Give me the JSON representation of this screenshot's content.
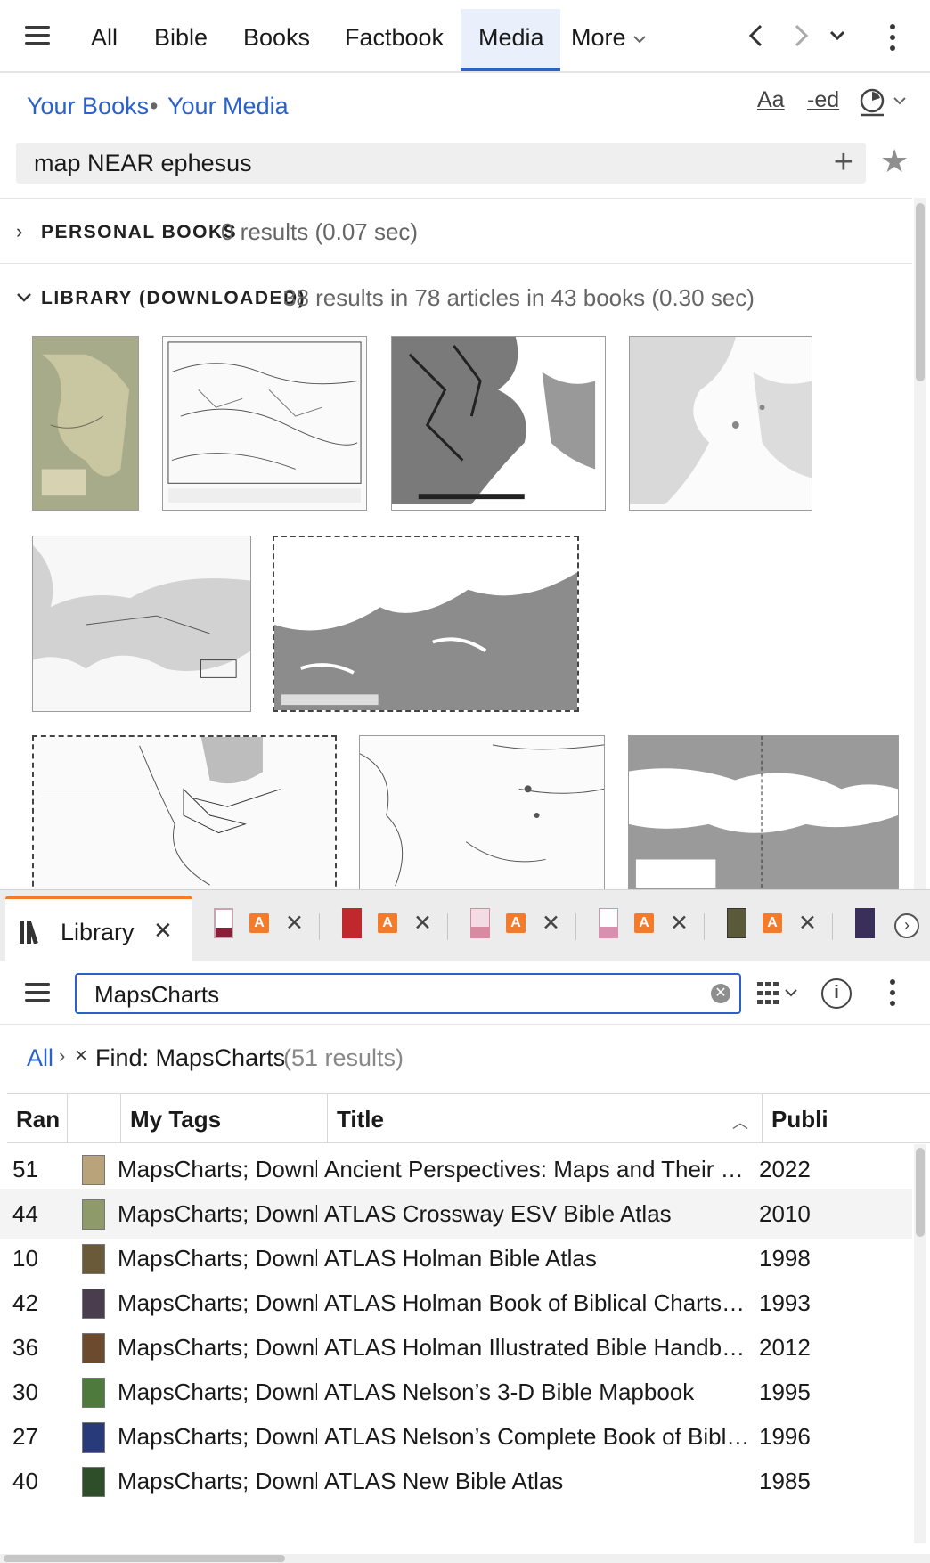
{
  "nav": {
    "tabs": [
      "All",
      "Bible",
      "Books",
      "Factbook",
      "Media"
    ],
    "active_tab": "Media",
    "more_label": "More"
  },
  "scope": {
    "your_books": "Your Books",
    "separator": "•",
    "your_media": "Your Media",
    "font_tool": "Aa",
    "ed_tool": "-ed"
  },
  "search": {
    "query": "map NEAR ephesus"
  },
  "sections": {
    "personal": {
      "title": "PERSONAL BOOKS",
      "meta": "0 results (0.07 sec)"
    },
    "library": {
      "title": "LIBRARY (DOWNLOADED)",
      "meta": "38 results in 78 articles in 43 books (0.30 sec)"
    }
  },
  "library_panel": {
    "tab_label": "Library",
    "doc_tab_badge": "A",
    "search_value": "MapsCharts",
    "breadcrumb": {
      "all": "All",
      "find": "Find: MapsCharts",
      "count": "(51 results)"
    },
    "columns": [
      "Ran",
      "",
      "My Tags",
      "Title",
      "Publi"
    ],
    "rows": [
      {
        "rank": "51",
        "tags": "MapsCharts; Downloa",
        "title": "Ancient Perspectives: Maps and Their Place in Mesopotamia, Egypt, Greece, and Rome",
        "year": "2022"
      },
      {
        "rank": "44",
        "tags": "MapsCharts; Downloa",
        "title": "ATLAS Crossway ESV Bible Atlas",
        "year": "2010"
      },
      {
        "rank": "10",
        "tags": "MapsCharts; Downloa",
        "title": "ATLAS Holman Bible Atlas",
        "year": "1998"
      },
      {
        "rank": "42",
        "tags": "MapsCharts; Downloa",
        "title": "ATLAS Holman Book of Biblical Charts, Maps, and Reconstructions",
        "year": "1993"
      },
      {
        "rank": "36",
        "tags": "MapsCharts; Downloa",
        "title": "ATLAS Holman Illustrated Bible Handbook",
        "year": "2012"
      },
      {
        "rank": "30",
        "tags": "MapsCharts; Downloa",
        "title": "ATLAS Nelson’s 3-D Bible Mapbook",
        "year": "1995"
      },
      {
        "rank": "27",
        "tags": "MapsCharts; Downloa",
        "title": "ATLAS Nelson’s Complete Book of Bible Maps and Charts",
        "year": "1996"
      },
      {
        "rank": "40",
        "tags": "MapsCharts; Downloa",
        "title": "ATLAS New Bible Atlas",
        "year": "1985"
      }
    ]
  },
  "colors": {
    "accent": "#2a62c9",
    "tab_accent": "#f27b2c",
    "book_covers": [
      "#b8a37a",
      "#8f9a6a",
      "#6b5a3a",
      "#4a3e4e",
      "#6b4a2e",
      "#4e7a3e",
      "#283a7a",
      "#2e4e2a"
    ],
    "doc_tab_books": [
      "#c9a3ad",
      "#c0282e",
      "#d78aa0",
      "#d98fb0",
      "#5a5a3a",
      "#3a2e5a"
    ]
  }
}
